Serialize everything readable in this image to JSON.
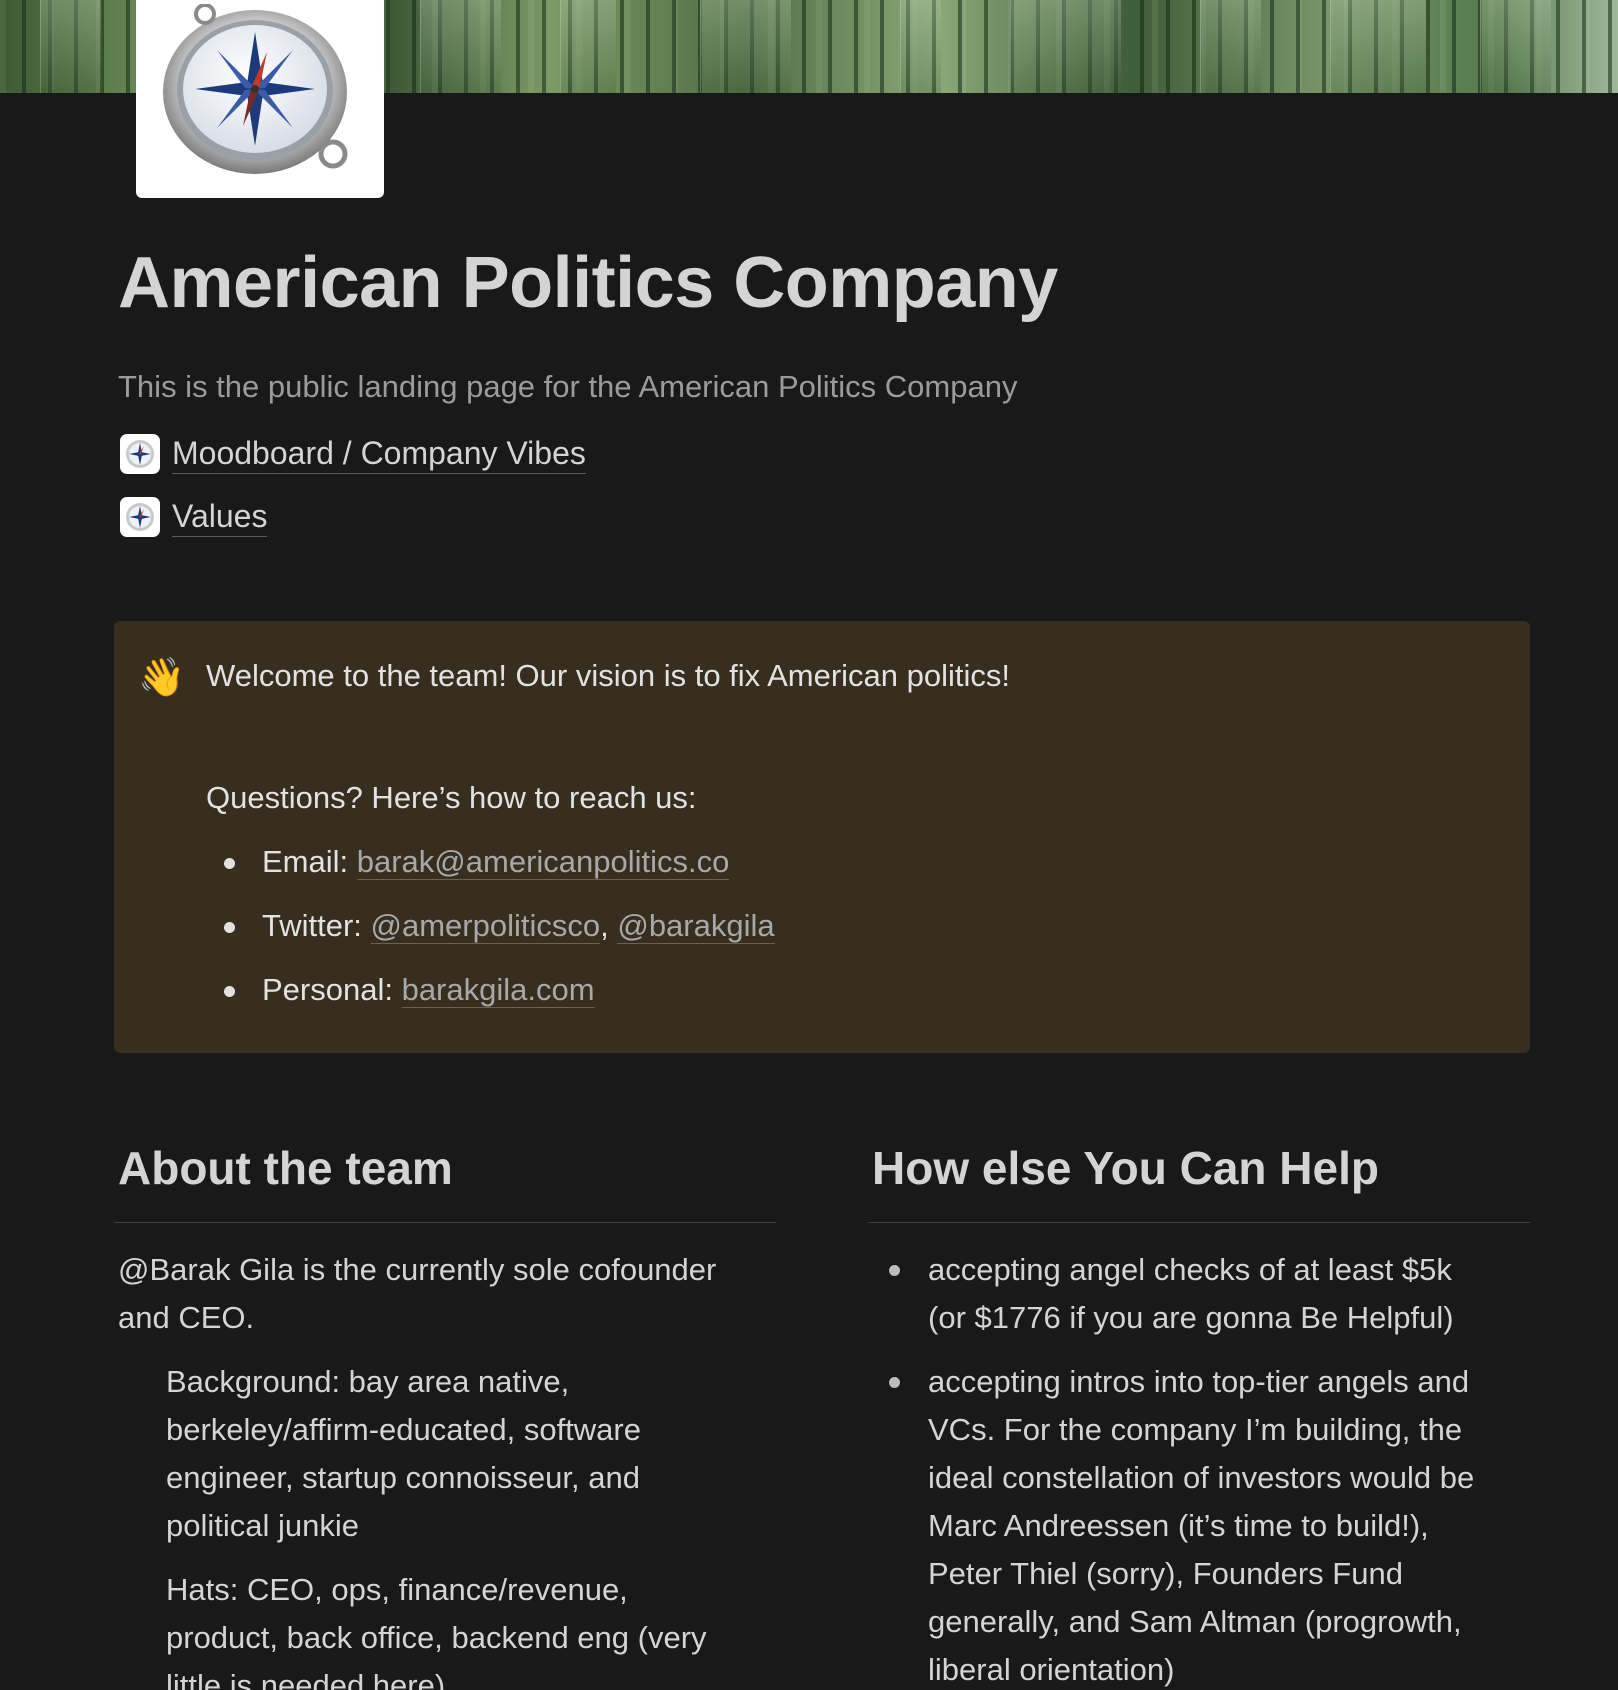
{
  "page": {
    "title": "American Politics Company",
    "description": "This is the public landing page for the American Politics Company",
    "cover_icon": "compass-icon"
  },
  "links": [
    {
      "label": "Moodboard / Company Vibes",
      "icon": "compass-icon"
    },
    {
      "label": "Values",
      "icon": "compass-icon"
    }
  ],
  "callout": {
    "emoji": "👋",
    "welcome": "Welcome to the team! Our vision is to fix American politics!",
    "questions": "Questions? Here’s how to reach us:",
    "email_label": "Email: ",
    "email_value": "barak@americanpolitics.co",
    "twitter_label": "Twitter: ",
    "twitter_handle_1": "@amerpoliticsco",
    "twitter_sep": ", ",
    "twitter_handle_2": "@barakgila",
    "personal_label": "Personal: ",
    "personal_value": "barakgila.com",
    "bg_color": "#372e20"
  },
  "about": {
    "heading": "About the team",
    "intro_line1": "@Barak Gila is the currently sole cofounder",
    "intro_line2": "and CEO.",
    "background_lines": [
      "Background: bay area native,",
      "berkeley/affirm-educated, software",
      "engineer, startup connoisseur, and",
      "political junkie"
    ],
    "hats_lines": [
      "Hats: CEO, ops, finance/revenue,",
      "product, back office, backend eng (very",
      "little is needed here)"
    ]
  },
  "help": {
    "heading": "How else You Can Help",
    "item1_lines": [
      "accepting angel checks of at least $5k",
      "(or $1776 if you are gonna Be Helpful)"
    ],
    "item2_lines": [
      "accepting intros into top-tier angels and",
      "VCs. For the company I’m building, the",
      "ideal constellation of investors would be",
      "Marc Andreessen (it’s time to build!),",
      "Peter Thiel (sorry), Founders Fund",
      "generally, and Sam Altman (progrowth,",
      "liberal orientation)"
    ]
  }
}
